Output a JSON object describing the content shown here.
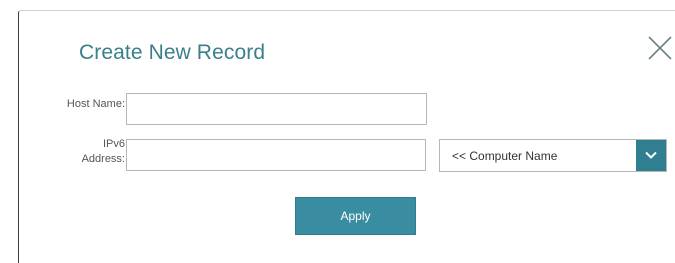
{
  "dialog": {
    "title": "Create New Record",
    "close_icon": "close-icon"
  },
  "form": {
    "host_name": {
      "label": "Host Name:",
      "value": "",
      "placeholder": ""
    },
    "ipv6_address": {
      "label_line1": "IPv6",
      "label_line2": "Address:",
      "value": "",
      "placeholder": ""
    },
    "computer_select": {
      "selected": "<< Computer Name",
      "arrow_icon": "chevron-down-icon"
    },
    "apply_label": "Apply"
  },
  "colors": {
    "accent": "#3a8da0",
    "title": "#3b7f8c",
    "select_arrow_bg": "#2f7f90"
  }
}
